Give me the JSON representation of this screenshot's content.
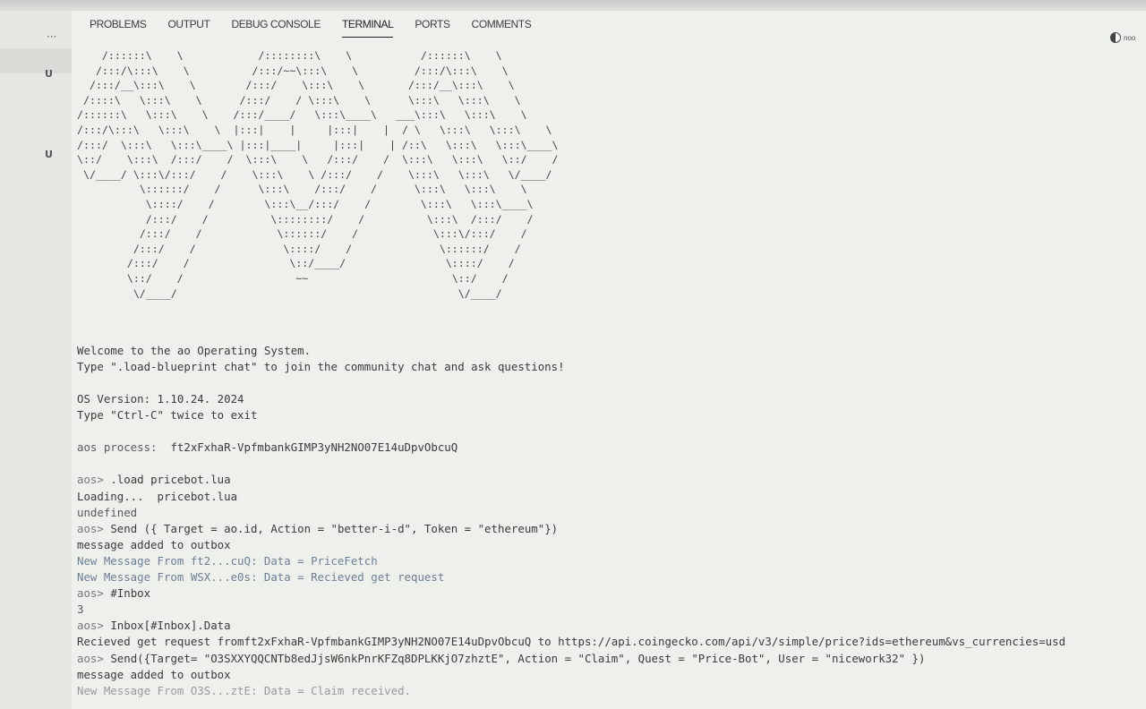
{
  "panel": {
    "ellipsis": "···",
    "tabs": [
      "PROBLEMS",
      "OUTPUT",
      "DEBUG CONSOLE",
      "TERMINAL",
      "PORTS",
      "COMMENTS"
    ],
    "active_tab": "TERMINAL",
    "right_label": "noo",
    "gutter_marks": [
      "U",
      "U"
    ]
  },
  "terminal": {
    "ascii_art": "    /::::::\\    \\            /::::::::\\    \\           /::::::\\    \\\n   /:::/\\:::\\    \\          /:::/~~\\:::\\    \\         /:::/\\:::\\    \\\n  /:::/__\\:::\\    \\        /:::/    \\:::\\    \\       /:::/__\\:::\\    \\\n /::::\\   \\:::\\    \\      /:::/    / \\:::\\    \\      \\:::\\   \\:::\\    \\\n/::::::\\   \\:::\\    \\    /:::/____/   \\:::\\____\\   ___\\:::\\   \\:::\\    \\\n/:::/\\:::\\   \\:::\\    \\  |:::|    |     |:::|    |  / \\   \\:::\\   \\:::\\    \\\n/:::/  \\:::\\   \\:::\\____\\ |:::|____|     |:::|    | /::\\   \\:::\\   \\:::\\____\\\n\\::/    \\:::\\  /:::/    /  \\:::\\    \\   /:::/    /  \\:::\\   \\:::\\   \\::/    /\n \\/____/ \\:::\\/:::/    /    \\:::\\    \\ /:::/    /    \\:::\\   \\:::\\   \\/____/\n          \\::::::/    /      \\:::\\    /:::/    /      \\:::\\   \\:::\\    \\\n           \\::::/    /        \\:::\\__/:::/    /        \\:::\\   \\:::\\____\\\n           /:::/    /          \\::::::::/    /          \\:::\\  /:::/    /\n          /:::/    /            \\::::::/    /            \\:::\\/:::/    /\n         /:::/    /              \\::::/    /              \\::::::/    /\n        /:::/    /                \\::/____/                \\::::/    /\n        \\::/    /                  ~~                       \\::/    /\n         \\/____/                                             \\/____/",
    "welcome": "Welcome to the ao Operating System.",
    "hint": "Type \".load-blueprint chat\" to join the community chat and ask questions!",
    "os_version": "OS Version: 1.10.24. 2024",
    "exit_hint": "Type \"Ctrl-C\" twice to exit",
    "process_label": "aos process:",
    "process_id": "ft2xFxhaR-VpfmbankGIMP3yNH2NO07E14uDpvObcuQ",
    "session": [
      {
        "prompt": "aos> ",
        "text": ".load pricebot.lua",
        "style": "cmd"
      },
      {
        "prompt": "",
        "text": "Loading...  pricebot.lua",
        "style": "out"
      },
      {
        "prompt": "",
        "text": "undefined",
        "style": "muted"
      },
      {
        "prompt": "aos> ",
        "text": "Send ({ Target = ao.id, Action = \"better-i-d\", Token = \"ethereum\"})",
        "style": "cmd"
      },
      {
        "prompt": "",
        "text": "message added to outbox",
        "style": "out"
      },
      {
        "prompt": "",
        "text": "New Message From ft2...cuQ: Data = PriceFetch",
        "style": "blue"
      },
      {
        "prompt": "",
        "text": "New Message From WSX...e0s: Data = Recieved get request",
        "style": "blue"
      },
      {
        "prompt": "aos> ",
        "text": "#Inbox",
        "style": "cmd"
      },
      {
        "prompt": "",
        "text": "3",
        "style": "muted"
      },
      {
        "prompt": "aos> ",
        "text": "Inbox[#Inbox].Data",
        "style": "cmd"
      },
      {
        "prompt": "",
        "text": "Recieved get request fromft2xFxhaR-VpfmbankGIMP3yNH2NO07E14uDpvObcuQ to https://api.coingecko.com/api/v3/simple/price?ids=ethereum&vs_currencies=usd",
        "style": "out"
      },
      {
        "prompt": "aos> ",
        "text": "Send({Target= \"O3SXXYQQCNTb8edJjsW6nkPnrKFZq8DPLKKjO7zhztE\", Action = \"Claim\", Quest = \"Price-Bot\", User = \"nicework32\" })",
        "style": "cmd"
      },
      {
        "prompt": "",
        "text": "message added to outbox",
        "style": "out"
      },
      {
        "prompt": "",
        "text": "New Message From O3S...ztE: Data = Claim received.",
        "style": "fade"
      }
    ]
  },
  "colors": {
    "background": "#eef0ec",
    "text": "#3b3b3b",
    "blue_text": "#6d7f95"
  }
}
